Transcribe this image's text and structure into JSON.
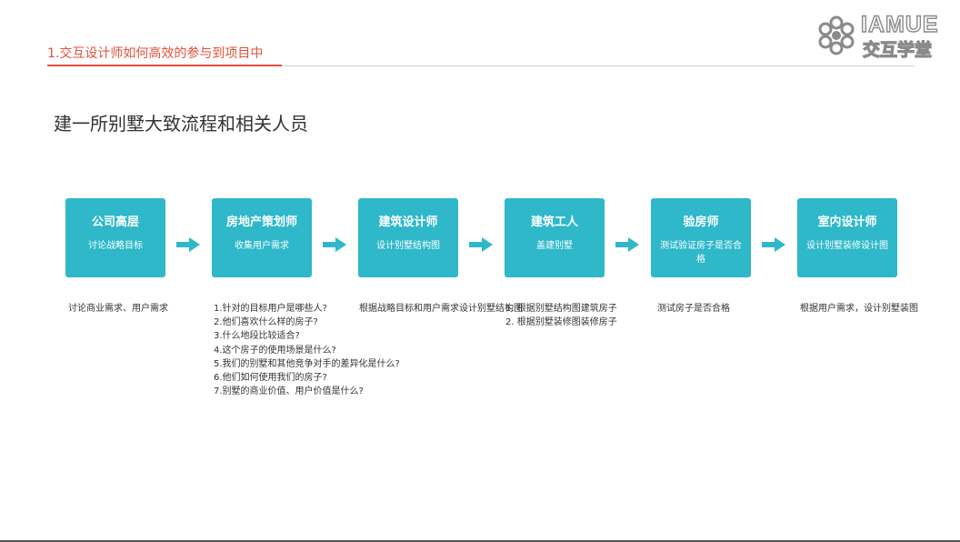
{
  "header": {
    "title": "1.交互设计师如何高效的参与到项目中"
  },
  "logo": {
    "text_en": "IAMUE",
    "text_cn": "交互学堂",
    "icon": "flower-ring-icon"
  },
  "main": {
    "title": "建一所别墅大致流程和相关人员"
  },
  "colors": {
    "accent": "#e0523c",
    "box": "#2eb8c9",
    "arrow": "#2eb8c9"
  },
  "steps": [
    {
      "title": "公司高层",
      "subtitle": "讨论战略目标",
      "details": [
        "讨论商业需求、用户需求"
      ]
    },
    {
      "title": "房地产策划师",
      "subtitle": "收集用户需求",
      "details": [
        "1.针对的目标用户是哪些人?",
        "2.他们喜欢什么样的房子?",
        "3.什么地段比较适合?",
        "4.这个房子的使用场景是什么?",
        "5.我们的别墅和其他竞争对手的差异化是什么?",
        "6.他们如何使用我们的房子?",
        "7.别墅的商业价值、用户价值是什么?"
      ]
    },
    {
      "title": "建筑设计师",
      "subtitle": "设计别墅结构图",
      "details": [
        "根据战略目标和用户需求设计别墅结构图"
      ]
    },
    {
      "title": "建筑工人",
      "subtitle": "盖建别墅",
      "details": [
        "1. 根据别墅结构图建筑房子",
        "2. 根据别墅装修图装修房子"
      ]
    },
    {
      "title": "验房师",
      "subtitle": "测试验证房子是否合格",
      "details": [
        "测试房子是否合格"
      ]
    },
    {
      "title": "室内设计师",
      "subtitle": "设计别墅装修设计图",
      "details": [
        "根据用户需求，设计别墅装图"
      ]
    }
  ]
}
